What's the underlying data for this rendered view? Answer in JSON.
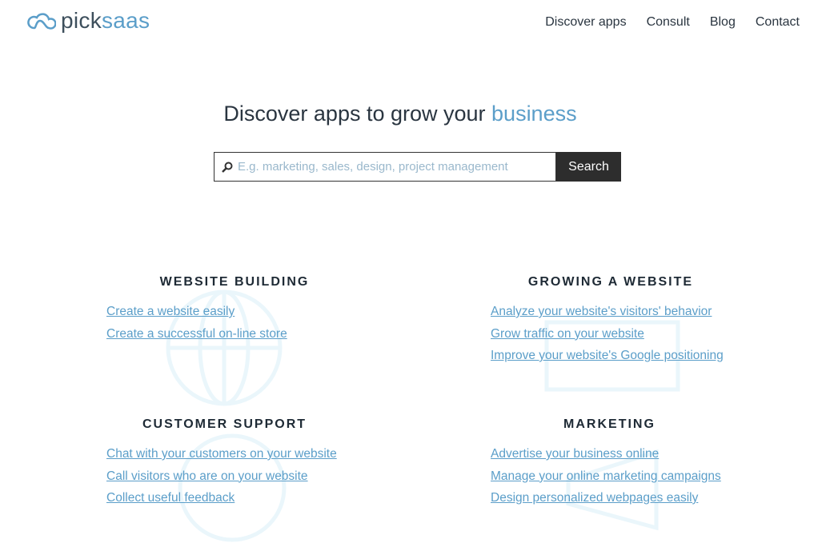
{
  "logo": {
    "part1": "pick",
    "part2": "saas"
  },
  "nav": [
    "Discover apps",
    "Consult",
    "Blog",
    "Contact"
  ],
  "hero": {
    "title": "Discover apps to grow your ",
    "accent": "business"
  },
  "search": {
    "placeholder": "E.g. marketing, sales, design, project management",
    "button": "Search"
  },
  "sections": [
    {
      "title": "WEBSITE BUILDING",
      "links": [
        "Create a website easily",
        "Create a successful on-line store"
      ]
    },
    {
      "title": "GROWING A WEBSITE",
      "links": [
        "Analyze your website's visitors' behavior",
        "Grow traffic on your website",
        "Improve your website's Google positioning"
      ]
    },
    {
      "title": "CUSTOMER SUPPORT",
      "links": [
        "Chat with your customers on your website",
        "Call visitors who are on your website",
        "Collect useful feedback"
      ]
    },
    {
      "title": "MARKETING",
      "links": [
        "Advertise your business online",
        "Manage your online marketing campaigns",
        "Design personalized webpages easily"
      ]
    }
  ]
}
